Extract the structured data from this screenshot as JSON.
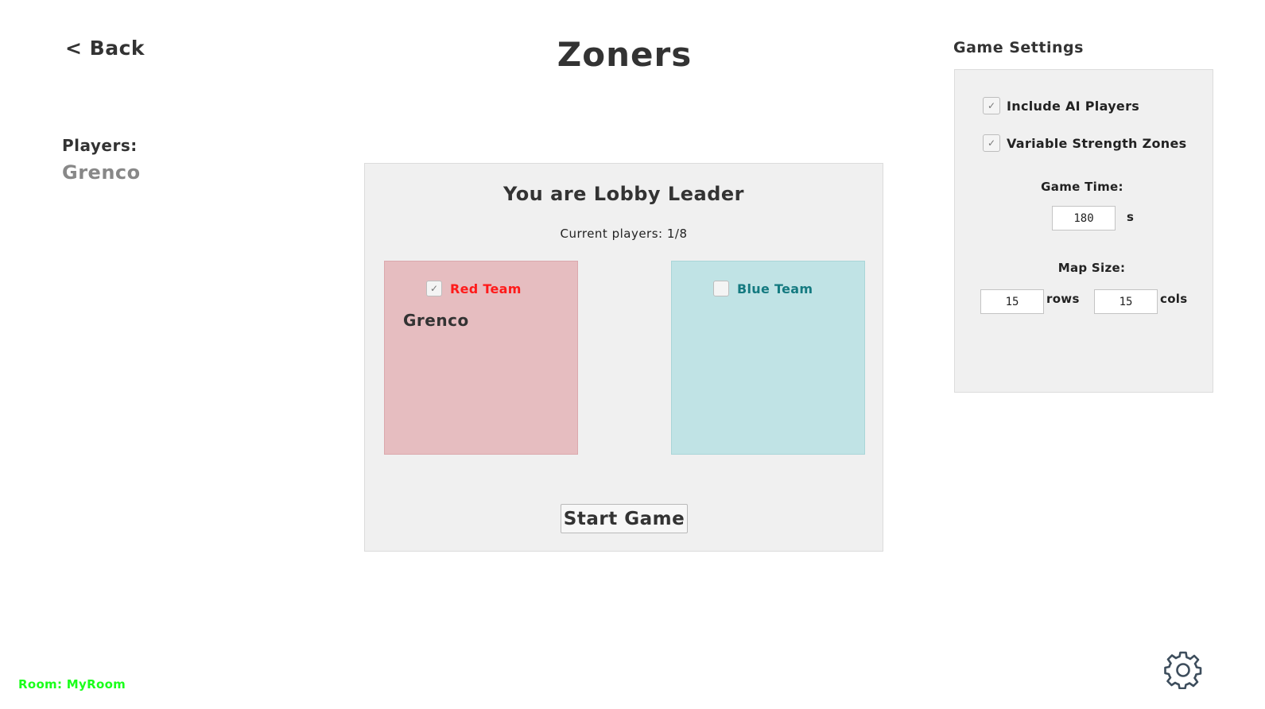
{
  "header": {
    "back_label": "< Back",
    "title": "Zoners"
  },
  "players": {
    "heading": "Players:",
    "names": [
      "Grenco"
    ]
  },
  "lobby": {
    "title": "You are Lobby Leader",
    "player_count": "Current players: 1/8",
    "teams": [
      {
        "label": "Red Team",
        "selected": true,
        "color": "#ff1a1a",
        "background": "#e6bdc0",
        "members": [
          "Grenco"
        ]
      },
      {
        "label": "Blue Team",
        "selected": false,
        "color": "#147a80",
        "background": "#c0e3e5",
        "members": []
      }
    ],
    "start_label": "Start Game"
  },
  "settings": {
    "heading": "Game Settings",
    "include_ai": {
      "label": "Include AI Players",
      "checked": true
    },
    "variable_zones": {
      "label": "Variable Strength Zones",
      "checked": true
    },
    "game_time": {
      "label": "Game Time:",
      "value": "180",
      "unit": "s"
    },
    "map_size": {
      "label": "Map Size:",
      "rows_value": "15",
      "rows_unit": "rows",
      "cols_value": "15",
      "cols_unit": "cols"
    }
  },
  "footer": {
    "room_label": "Room: MyRoom",
    "room_color": "#1aff1a",
    "settings_icon": "gear-icon"
  }
}
